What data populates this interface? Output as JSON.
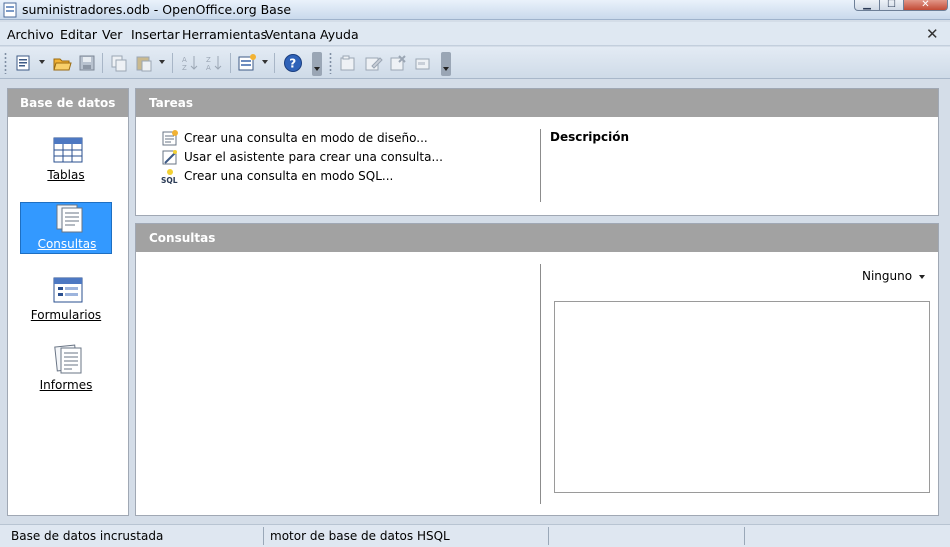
{
  "window": {
    "title": "suministradores.odb - OpenOffice.org Base",
    "minimize_glyph": "▁",
    "maximize_glyph": "☐",
    "close_glyph": "✕"
  },
  "menubar": {
    "items": [
      "Archivo",
      "Editar",
      "Ver",
      "Insertar",
      "Herramientas",
      "Ventana",
      "Ayuda"
    ],
    "close_glyph": "✕"
  },
  "toolbar": {
    "icons": [
      "new-document-icon",
      "open-folder-icon",
      "save-icon",
      "copy-icon",
      "paste-icon",
      "sort-ascending-icon",
      "sort-descending-icon",
      "form-design-icon",
      "help-icon",
      "open-object-icon",
      "edit-object-icon",
      "delete-object-icon",
      "rename-object-icon"
    ]
  },
  "left_panel": {
    "title": "Base de datos",
    "items": [
      {
        "label": "Tablas",
        "icon": "table-icon",
        "selected": false
      },
      {
        "label": "Consultas",
        "icon": "query-icon",
        "selected": true
      },
      {
        "label": "Formularios",
        "icon": "form-icon",
        "selected": false
      },
      {
        "label": "Informes",
        "icon": "report-icon",
        "selected": false
      }
    ]
  },
  "tasks_panel": {
    "title": "Tareas",
    "tasks": [
      {
        "label": "Crear una consulta en modo de diseño...",
        "icon": "design-query-icon"
      },
      {
        "label": "Usar el asistente para crear una consulta...",
        "icon": "wizard-icon"
      },
      {
        "label": "Crear una consulta en modo SQL...",
        "icon": "sql-icon"
      }
    ],
    "description_title": "Descripción"
  },
  "queries_panel": {
    "title": "Consultas",
    "preview_mode": "Ninguno"
  },
  "statusbar": {
    "cells": [
      "Base de datos incrustada",
      "motor de base de datos HSQL",
      "",
      ""
    ]
  },
  "colors": {
    "panel_header": "#a2a2a2",
    "selection": "#3399ff",
    "background": "#d4dde8"
  }
}
